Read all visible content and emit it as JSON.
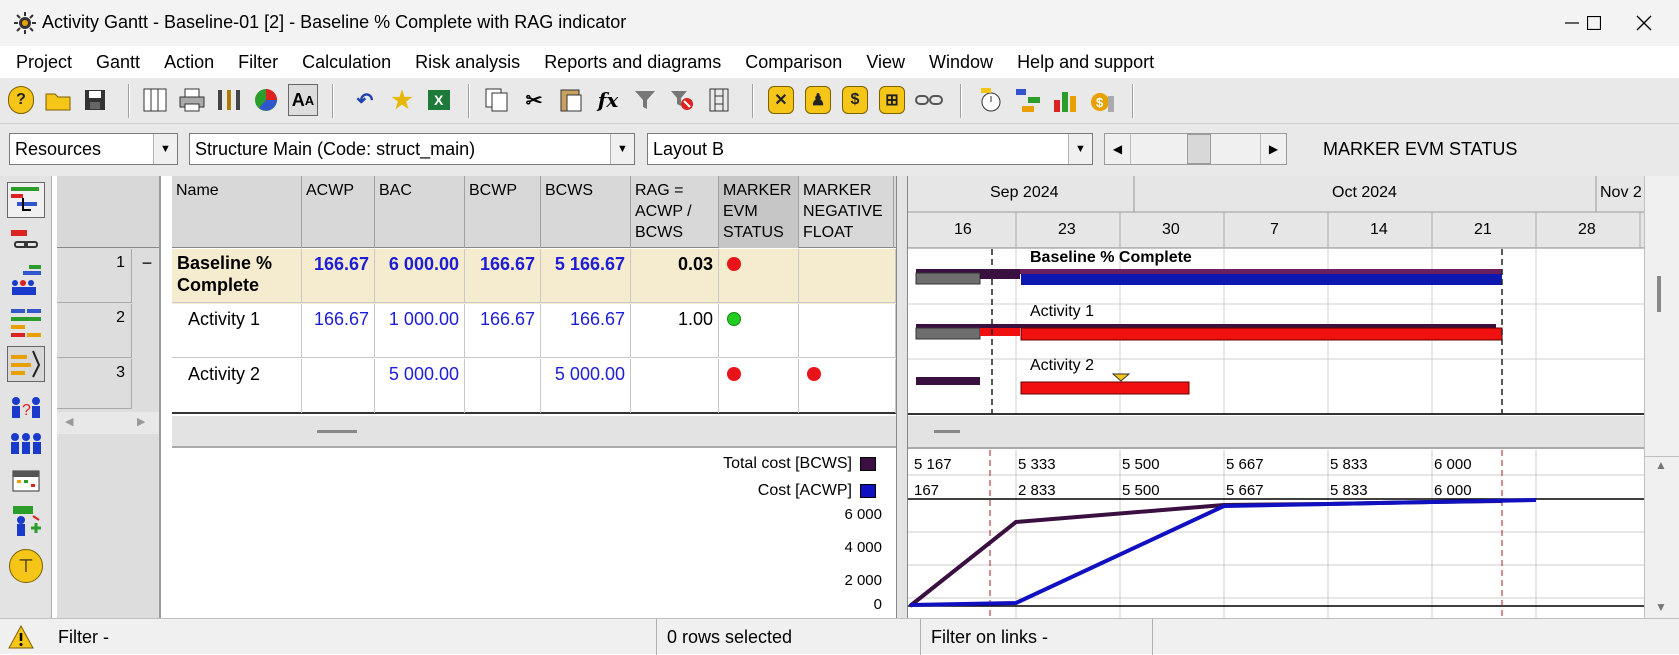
{
  "window": {
    "title": "Activity Gantt - Baseline-01 [2] - Baseline % Complete with RAG indicator"
  },
  "menu": [
    "Project",
    "Gantt",
    "Action",
    "Filter",
    "Calculation",
    "Risk analysis",
    "Reports and diagrams",
    "Comparison",
    "View",
    "Window",
    "Help and support"
  ],
  "toolbar": {
    "formula_symbol": "fx"
  },
  "combos": {
    "resources": "Resources",
    "structure": "Structure Main (Code: struct_main)",
    "layout": "Layout B",
    "marker_label": "MARKER EVM STATUS"
  },
  "table": {
    "columns": [
      "Name",
      "ACWP",
      "BAC",
      "BCWP",
      "BCWS",
      "RAG = ACWP / BCWS",
      "MARKER EVM STATUS",
      "MARKER NEGATIVE FLOAT"
    ],
    "rows": [
      {
        "num": "1",
        "collapse": "−",
        "name": "Baseline % Complete",
        "acwp": "166.67",
        "bac": "6 000.00",
        "bcwp": "166.67",
        "bcws": "5 166.67",
        "rag": "0.03",
        "evm_status": "red",
        "negative_float": ""
      },
      {
        "num": "2",
        "name": "Activity 1",
        "acwp": "166.67",
        "bac": "1 000.00",
        "bcwp": "166.67",
        "bcws": "166.67",
        "rag": "1.00",
        "evm_status": "green",
        "negative_float": ""
      },
      {
        "num": "3",
        "name": "Activity 2",
        "acwp": "",
        "bac": "5 000.00",
        "bcwp": "",
        "bcws": "5 000.00",
        "rag": "",
        "evm_status": "red",
        "negative_float": "red"
      }
    ]
  },
  "gantt": {
    "months": [
      "Sep 2024",
      "Oct 2024",
      "Nov 2"
    ],
    "weeks": [
      "16",
      "23",
      "30",
      "7",
      "14",
      "21",
      "28"
    ],
    "bar_labels": [
      "Baseline % Complete",
      "Activity 1",
      "Activity 2"
    ]
  },
  "histogram": {
    "legend": [
      {
        "label": "Total cost [BCWS]",
        "color": "#3a1040"
      },
      {
        "label": "Cost [ACWP]",
        "color": "#1010c0"
      }
    ],
    "bcws_row": [
      "5 167",
      "5 333",
      "5 500",
      "5 667",
      "5 833",
      "6 000"
    ],
    "acwp_row": [
      "167",
      "2 833",
      "5 500",
      "5 667",
      "5 833",
      "6 000"
    ],
    "y_ticks": [
      "6 000",
      "4 000",
      "2 000",
      "0"
    ]
  },
  "status": {
    "filter": "Filter -",
    "rows_selected": "0 rows selected",
    "filter_links": "Filter on links -"
  },
  "colors": {
    "red": "#e8141a",
    "green": "#22cc22",
    "bar_blue": "#0d18b0",
    "bar_red": "#f01010",
    "bar_gray": "#6e6e6e",
    "bar_purple": "#3a1040",
    "summary_row_bg": "#f5ecd0"
  }
}
